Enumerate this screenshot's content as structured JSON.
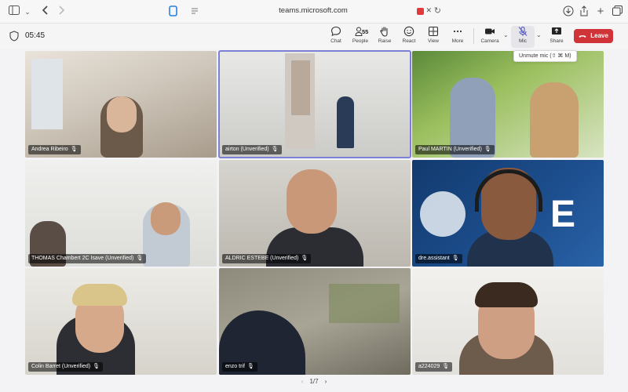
{
  "browser": {
    "url": "teams.microsoft.com"
  },
  "toolbar": {
    "timer": "05:45",
    "chat_label": "Chat",
    "people_label": "People",
    "people_count": "55",
    "raise_label": "Raise",
    "react_label": "React",
    "view_label": "View",
    "more_label": "More",
    "camera_label": "Camera",
    "mic_label": "Mic",
    "share_label": "Share",
    "leave_label": "Leave",
    "mic_tooltip": "Unmute mic (⇧ ⌘ M)"
  },
  "participants": [
    {
      "name": "Andrea Ribeiro"
    },
    {
      "name": "airton (Unverified)"
    },
    {
      "name": "Paul MARTIN (Unverified)"
    },
    {
      "name": "THOMAS Chambert 2C Isave (Unverified)"
    },
    {
      "name": "ALDRIC ESTEBE (Unverified)"
    },
    {
      "name": "dre.assistant"
    },
    {
      "name": "Colin Barret (Unverified)"
    },
    {
      "name": "enzo trif"
    },
    {
      "name": "a224029"
    }
  ],
  "pagination": {
    "label": "1/7"
  },
  "colors": {
    "leave": "#d13438",
    "selected_outline": "#7b7fd6"
  }
}
